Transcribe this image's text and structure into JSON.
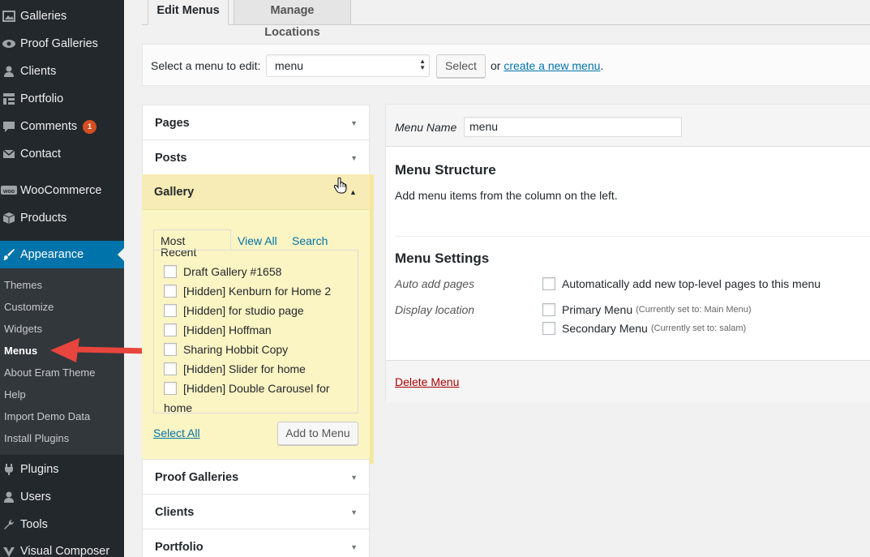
{
  "sidebar": {
    "items": [
      {
        "label": "Galleries",
        "icon": "image-icon"
      },
      {
        "label": "Proof Galleries",
        "icon": "eye-icon"
      },
      {
        "label": "Clients",
        "icon": "users-icon"
      },
      {
        "label": "Portfolio",
        "icon": "grid-icon"
      },
      {
        "label": "Comments",
        "icon": "comment-icon",
        "badge": "1"
      },
      {
        "label": "Contact",
        "icon": "mail-icon"
      },
      {
        "label": "WooCommerce",
        "icon": "woo-icon"
      },
      {
        "label": "Products",
        "icon": "box-icon"
      },
      {
        "label": "Appearance",
        "icon": "brush-icon"
      },
      {
        "label": "Plugins",
        "icon": "plug-icon"
      },
      {
        "label": "Users",
        "icon": "user-icon"
      },
      {
        "label": "Tools",
        "icon": "wrench-icon"
      },
      {
        "label": "Visual Composer",
        "icon": "vc-icon"
      }
    ],
    "submenu": [
      "Themes",
      "Customize",
      "Widgets",
      "Menus",
      "About Eram Theme",
      "Help",
      "Import Demo Data",
      "Install Plugins"
    ]
  },
  "tabs": {
    "edit": "Edit Menus",
    "manage": "Manage Locations"
  },
  "select_bar": {
    "label": "Select a menu to edit:",
    "selected": "menu",
    "button": "Select",
    "or": "or",
    "link": "create a new menu",
    "period": "."
  },
  "accordion": {
    "pages": "Pages",
    "posts": "Posts",
    "gallery": "Gallery",
    "proof_galleries": "Proof Galleries",
    "clients": "Clients",
    "portfolio": "Portfolio"
  },
  "gallery_box": {
    "tabs": [
      "Most Recent",
      "View All",
      "Search"
    ],
    "items": [
      "Draft Gallery #1658",
      "[Hidden] Kenburn for Home 2",
      "[Hidden] for studio page",
      "[Hidden] Hoffman",
      "Sharing Hobbit Copy",
      "[Hidden] Slider for home",
      "[Hidden] Double Carousel for",
      "home"
    ],
    "select_all": "Select All",
    "add_button": "Add to Menu"
  },
  "menu_panel": {
    "name_label": "Menu Name",
    "name_value": "menu",
    "structure_title": "Menu Structure",
    "structure_text": "Add menu items from the column on the left.",
    "settings_title": "Menu Settings",
    "auto_add_label": "Auto add pages",
    "auto_add_option": "Automatically add new top-level pages to this menu",
    "display_label": "Display location",
    "locations": [
      {
        "name": "Primary Menu",
        "note": "(Currently set to: Main Menu)"
      },
      {
        "name": "Secondary Menu",
        "note": "(Currently set to: salam)"
      }
    ],
    "delete": "Delete Menu"
  },
  "colors": {
    "sidebar": "#23282d",
    "accent": "#0073aa",
    "highlight": "#fbf4c3",
    "arrow": "#e8453c",
    "delete": "#aa0000"
  }
}
